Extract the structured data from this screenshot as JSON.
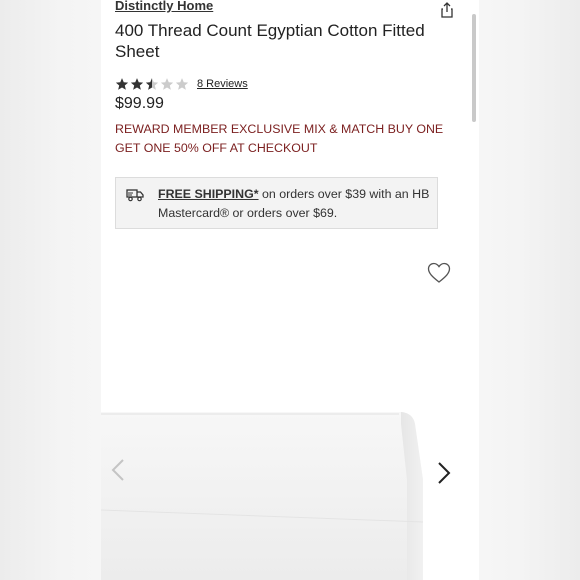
{
  "header": {
    "brand": "Distinctly Home",
    "share_icon": "share-icon"
  },
  "product": {
    "title": "400 Thread Count Egyptian Cotton Fitted Sheet",
    "rating": {
      "value": 2.5,
      "max": 5,
      "reviews_label": "8 Reviews"
    },
    "price": "$99.99",
    "promo": "REWARD MEMBER EXCLUSIVE MIX & MATCH BUY ONE GET ONE 50% OFF AT CHECKOUT"
  },
  "shipping": {
    "icon": "truck-icon",
    "link_label": "FREE SHIPPING*",
    "text": " on orders over $39 with an HB Mastercard® or orders over $69."
  },
  "gallery": {
    "wishlist_icon": "heart-icon",
    "prev_icon": "chevron-left-icon",
    "next_icon": "chevron-right-icon"
  },
  "colors": {
    "promo": "#7b1f1f",
    "star_filled": "#333333",
    "star_empty": "#cccccc"
  }
}
